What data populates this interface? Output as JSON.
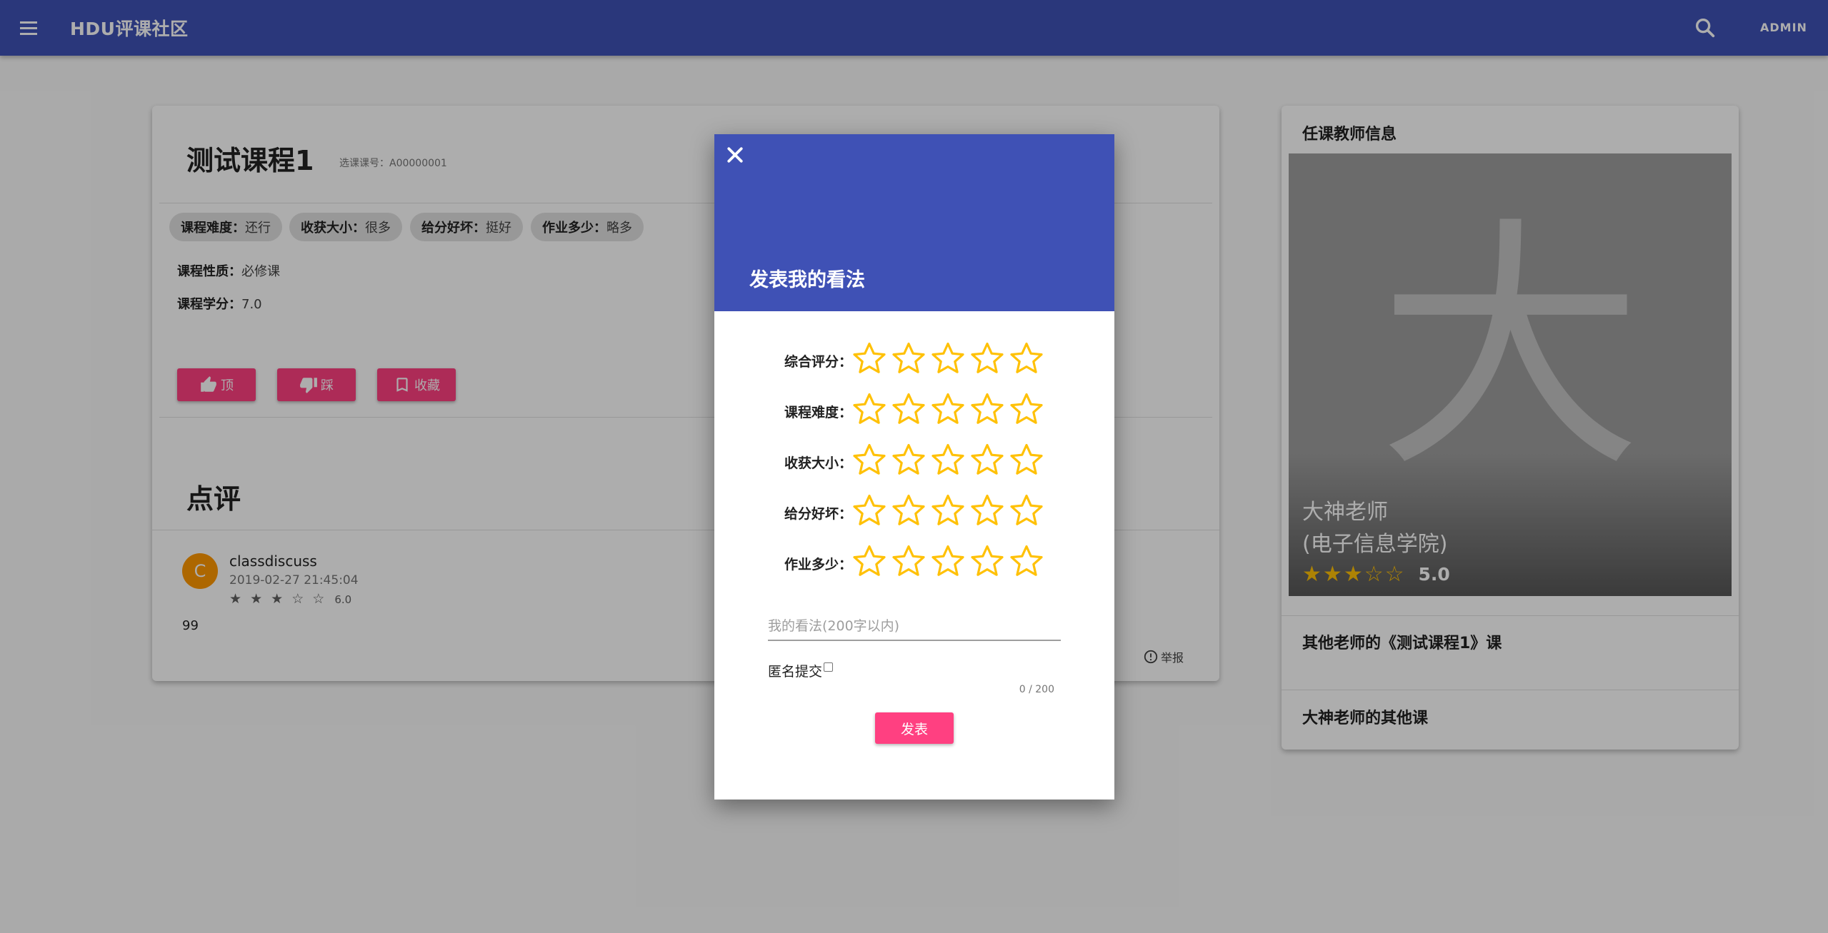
{
  "app": {
    "title": "HDU评课社区",
    "admin_label": "ADMIN",
    "primary_color": "#3f51b5",
    "accent_color": "#ff4081"
  },
  "course": {
    "title": "测试课程1",
    "code": "选课课号：A00000001",
    "chips": [
      {
        "label": "课程难度：",
        "value": "还行"
      },
      {
        "label": "收获大小：",
        "value": "很多"
      },
      {
        "label": "给分好坏：",
        "value": "挺好"
      },
      {
        "label": "作业多少：",
        "value": "略多"
      }
    ],
    "nature_label": "课程性质：",
    "nature_value": "必修课",
    "credit_label": "课程学分：",
    "credit_value": "7.0",
    "buttons": {
      "like": "顶",
      "dislike": "踩",
      "favorite": "收藏"
    }
  },
  "reviews": {
    "section_title": "点评",
    "items": [
      {
        "avatar_letter": "C",
        "user": "classdiscuss",
        "time": "2019-02-27 21:45:04",
        "stars": "★ ★ ★ ☆ ☆",
        "rating": 3,
        "score": "6.0",
        "body": "99",
        "report_label": "举报"
      }
    ]
  },
  "teacher": {
    "heading": "任课教师信息",
    "avatar_char": "大",
    "name": "大神老师",
    "school": "(电子信息学院)",
    "rating": 3,
    "score": "5.0",
    "other_teachers_course": "其他老师的《测试课程1》课",
    "teacher_other_courses": "大神老师的其他课"
  },
  "dialog": {
    "title": "发表我的看法",
    "ratings": [
      {
        "label": "综合评分：",
        "value": 0
      },
      {
        "label": "课程难度：",
        "value": 0
      },
      {
        "label": "收获大小：",
        "value": 0
      },
      {
        "label": "给分好坏：",
        "value": 0
      },
      {
        "label": "作业多少：",
        "value": 0
      }
    ],
    "star_color": "#ffc107",
    "comment_placeholder": "我的看法(200字以内)",
    "comment_value": "",
    "anonymous_label": "匿名提交",
    "anonymous_checked": false,
    "char_count": "0 / 200",
    "submit_label": "发表"
  }
}
